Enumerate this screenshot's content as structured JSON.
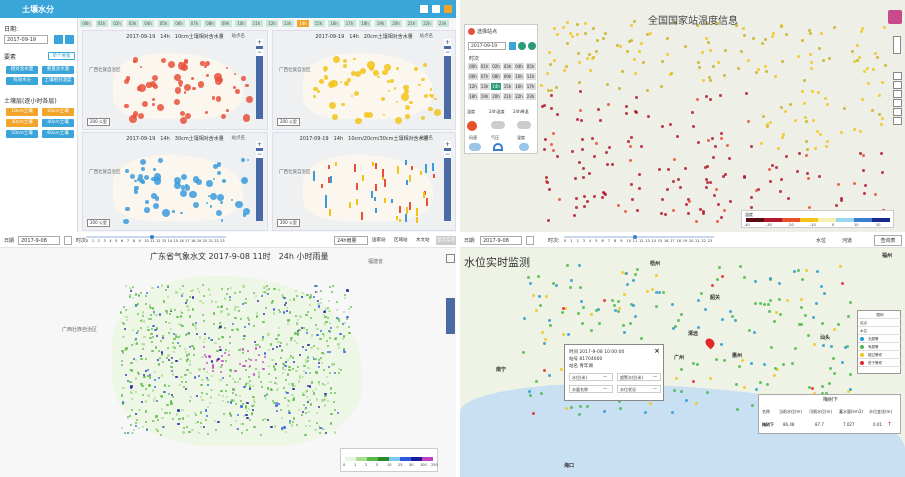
{
  "tl": {
    "title": "土壤水分",
    "date_label": "日期:",
    "date_value": "2017-09-19",
    "hours": [
      "00h",
      "01h",
      "02h",
      "03h",
      "04h",
      "05h",
      "06h",
      "07h",
      "08h",
      "09h",
      "10h",
      "11h",
      "12h",
      "13h",
      "14h",
      "15h",
      "16h",
      "17h",
      "18h",
      "19h",
      "20h",
      "21h",
      "22h",
      "23h"
    ],
    "active_hour": "14h",
    "section1": "要素",
    "section1_toggle": "单个要素",
    "elem_buttons": [
      "相对含水量",
      "重量含水量",
      "有效水分",
      "土壤相对湿度"
    ],
    "section2": "土壤层(逐小时各层)",
    "layer_buttons": [
      "10cm土壤",
      "20cm土壤",
      "30cm土壤",
      "40cm土壤",
      "50cm土壤",
      "60cm土壤"
    ],
    "maps": [
      {
        "title": "2017-09-19　14h　10cm土壤相对含水量",
        "link": "站点名"
      },
      {
        "title": "2017-09-19　14h　20cm土壤相对含水量",
        "link": "站点名"
      },
      {
        "title": "2017-09-19　14h　30cm土壤相对含水量",
        "link": "站点名"
      },
      {
        "title": "2017-09-19　14h　10cm/20cm/30cm土壤相对含水量",
        "link": "站点名"
      }
    ],
    "place_label": "广西壮族自治区",
    "scale": "200 公里",
    "colors": {
      "bar": "#3aa5d8",
      "red": "#e8503a",
      "yellow": "#f2c41a",
      "blue": "#3a9bdc"
    }
  },
  "tr": {
    "title": "全国国家站温度信息",
    "panel_head": "选择站点",
    "date": "2017-09-19",
    "time_label": "时次",
    "times": [
      "00h",
      "01h",
      "02h",
      "03h",
      "04h",
      "05h",
      "06h",
      "07h",
      "08h",
      "09h",
      "10h",
      "11h",
      "12h",
      "13h",
      "14h",
      "15h",
      "16h",
      "17h",
      "18h",
      "19h",
      "20h",
      "21h",
      "22h",
      "23h"
    ],
    "layer_labels": [
      "温度",
      "24h温度",
      "24h降温",
      "风速",
      "气压",
      "湿度"
    ],
    "legend_title": "温度",
    "legend_ticks": [
      "-40",
      "-30",
      "-20",
      "-10",
      "0",
      "10",
      "20"
    ],
    "legend_colors": [
      "#5a0a14",
      "#b0192d",
      "#e8502a",
      "#f2c41a",
      "#f5f0b0",
      "#9ad6f0",
      "#3a7cd0",
      "#1a2a8a"
    ]
  },
  "bl": {
    "date_label": "日期",
    "date_value": "2017-9-08",
    "time_label": "时次:",
    "hours": [
      "0",
      "1",
      "2",
      "3",
      "4",
      "5",
      "6",
      "7",
      "8",
      "9",
      "10",
      "11",
      "12",
      "13",
      "14",
      "15",
      "16",
      "17",
      "18",
      "19",
      "20",
      "21",
      "22",
      "23"
    ],
    "dropdown": "24h雨量",
    "checks": [
      "国家站",
      "区域站",
      "水文站"
    ],
    "button": "显示实况",
    "title_prefix": "广东省气象水文",
    "title_main": "2017-9-08 11时　24h 小时雨量",
    "region_label": "广西壮族自治区",
    "right_label": "福建省",
    "legend_ticks": [
      "0",
      "1",
      "2",
      "5",
      "10",
      "25",
      "50",
      "100",
      "250"
    ],
    "legend_colors": [
      "#e8f5e0",
      "#a8dc90",
      "#5ab848",
      "#2a8a2a",
      "#7ac8f0",
      "#2a5ae0",
      "#1a1a9a",
      "#c040c0"
    ]
  },
  "br": {
    "date_label": "日期:",
    "date_value": "2017-9-08",
    "time_label": "时次:",
    "hours": [
      "0",
      "1",
      "2",
      "3",
      "4",
      "5",
      "6",
      "7",
      "8",
      "9",
      "10",
      "11",
      "12",
      "13",
      "14",
      "15",
      "16",
      "17",
      "18",
      "19",
      "20",
      "21",
      "22",
      "23"
    ],
    "checks": [
      "水位",
      "河道"
    ],
    "button": "查询表",
    "title": "水位实时监测",
    "cities": [
      "梧州",
      "南宁",
      "广州",
      "福州",
      "海口",
      "江门",
      "惠州",
      "汕头",
      "韶关",
      "清远"
    ],
    "popup": {
      "time": "时间 2017-9-08 10:00:00",
      "code": "站号 81704600",
      "name": "站名 青年湖",
      "cells": [
        "水位(米)",
        "超警水位(米)",
        "水量名称",
        "水位状况"
      ],
      "vals": [
        "—",
        "—",
        "—",
        "—"
      ]
    },
    "legend": {
      "head": "图例",
      "rows": [
        "站点",
        "水位",
        "无超警",
        "有超警",
        "超过警戒",
        "低于警戒"
      ]
    },
    "table": {
      "head": "梅树下",
      "cols": [
        "名称",
        "当前水位(m)",
        "汛限水位(m)",
        "蓄水量(km3)",
        "水位变化(m)"
      ],
      "row": [
        "梅树下",
        "86.48",
        "87.7",
        "7.027",
        "0.01"
      ]
    }
  }
}
